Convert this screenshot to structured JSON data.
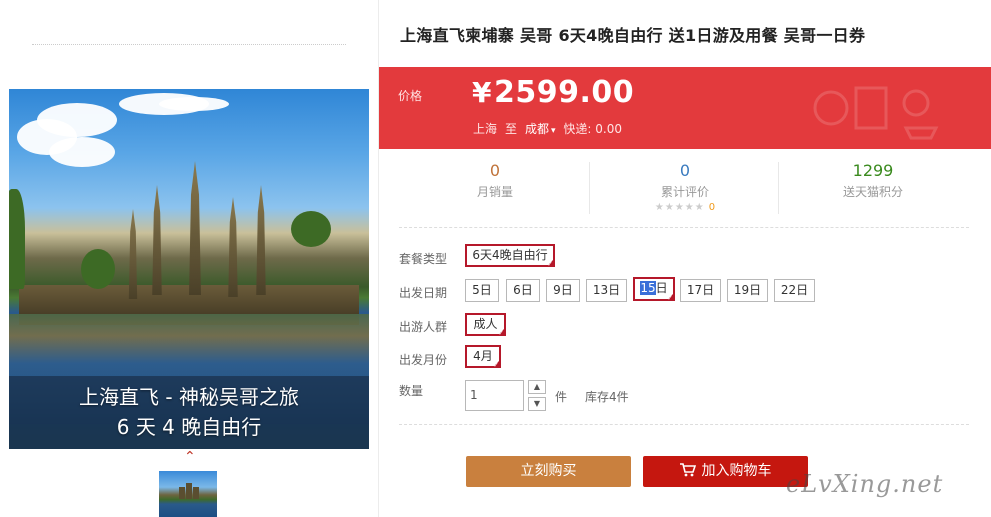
{
  "product": {
    "title": "上海直飞柬埔寨 吴哥 6天4晚自由行 送1日游及用餐 吴哥一日券"
  },
  "gallery": {
    "caption_line1": "上海直飞 - 神秘吴哥之旅",
    "caption_line2": "6 天 4 晚自由行",
    "thumb_arrow": "⌃"
  },
  "price": {
    "label": "价格",
    "currency": "¥",
    "amount": "2599.00",
    "from_city": "上海",
    "to_word": "至",
    "to_city": "成都",
    "shipping": "快递: 0.00"
  },
  "stats": {
    "monthly_sales": {
      "value": "0",
      "label": "月销量",
      "color": "#c0733a"
    },
    "reviews": {
      "value": "0",
      "label": "累计评价",
      "stars": "★★★★★",
      "score": "0",
      "color": "#3a7bbf"
    },
    "points": {
      "value": "1299",
      "label": "送天猫积分",
      "color": "#3a8a1e"
    }
  },
  "options": {
    "package": {
      "label": "套餐类型",
      "values": [
        "6天4晚自由行"
      ],
      "selected": "6天4晚自由行"
    },
    "date": {
      "label": "出发日期",
      "values": [
        "5日",
        "6日",
        "9日",
        "13日",
        "15日",
        "17日",
        "19日",
        "22日"
      ],
      "selected": "15日"
    },
    "group": {
      "label": "出游人群",
      "values": [
        "成人"
      ],
      "selected": "成人"
    },
    "month": {
      "label": "出发月份",
      "values": [
        "4月"
      ],
      "selected": "4月"
    },
    "quantity": {
      "label": "数量",
      "value": "1",
      "unit": "件",
      "stock": "库存4件"
    }
  },
  "actions": {
    "buy_now": "立刻购买",
    "add_to_cart": "加入购物车",
    "buy_color": "#c9803e",
    "cart_color": "#c5170f"
  },
  "watermark": "eLvXing.net",
  "colors": {
    "accent_red": "#e33a3d",
    "selected_border": "#b5182a"
  }
}
